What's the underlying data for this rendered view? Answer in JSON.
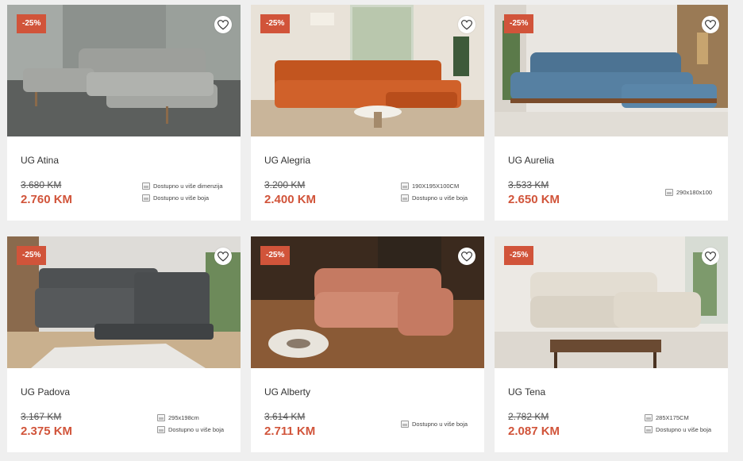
{
  "colors": {
    "accent": "#d1543a",
    "background": "#efefef",
    "card": "#ffffff"
  },
  "products": [
    {
      "name": "UG Atina",
      "discount": "-25%",
      "old_price": "3.680 KM",
      "new_price": "2.760 KM",
      "features": [
        "Dostupno u više dimenzija",
        "Dostupno u više boja"
      ]
    },
    {
      "name": "UG Alegria",
      "discount": "-25%",
      "old_price": "3.200 KM",
      "new_price": "2.400 KM",
      "features": [
        "190X195X100CM",
        "Dostupno u više boja"
      ]
    },
    {
      "name": "UG Aurelia",
      "discount": "-25%",
      "old_price": "3.533 KM",
      "new_price": "2.650 KM",
      "features": [
        "290x180x100"
      ]
    },
    {
      "name": "UG Padova",
      "discount": "-25%",
      "old_price": "3.167 KM",
      "new_price": "2.375 KM",
      "features": [
        "295x198cm",
        "Dostupno u više boja"
      ]
    },
    {
      "name": "UG Alberty",
      "discount": "-25%",
      "old_price": "3.614 KM",
      "new_price": "2.711 KM",
      "features": [
        "Dostupno u više boja"
      ]
    },
    {
      "name": "UG Tena",
      "discount": "-25%",
      "old_price": "2.782 KM",
      "new_price": "2.087 KM",
      "features": [
        "285X175CM",
        "Dostupno u više boja"
      ]
    }
  ],
  "icons": {
    "wishlist": "heart-icon",
    "feature": "dimension-icon"
  }
}
